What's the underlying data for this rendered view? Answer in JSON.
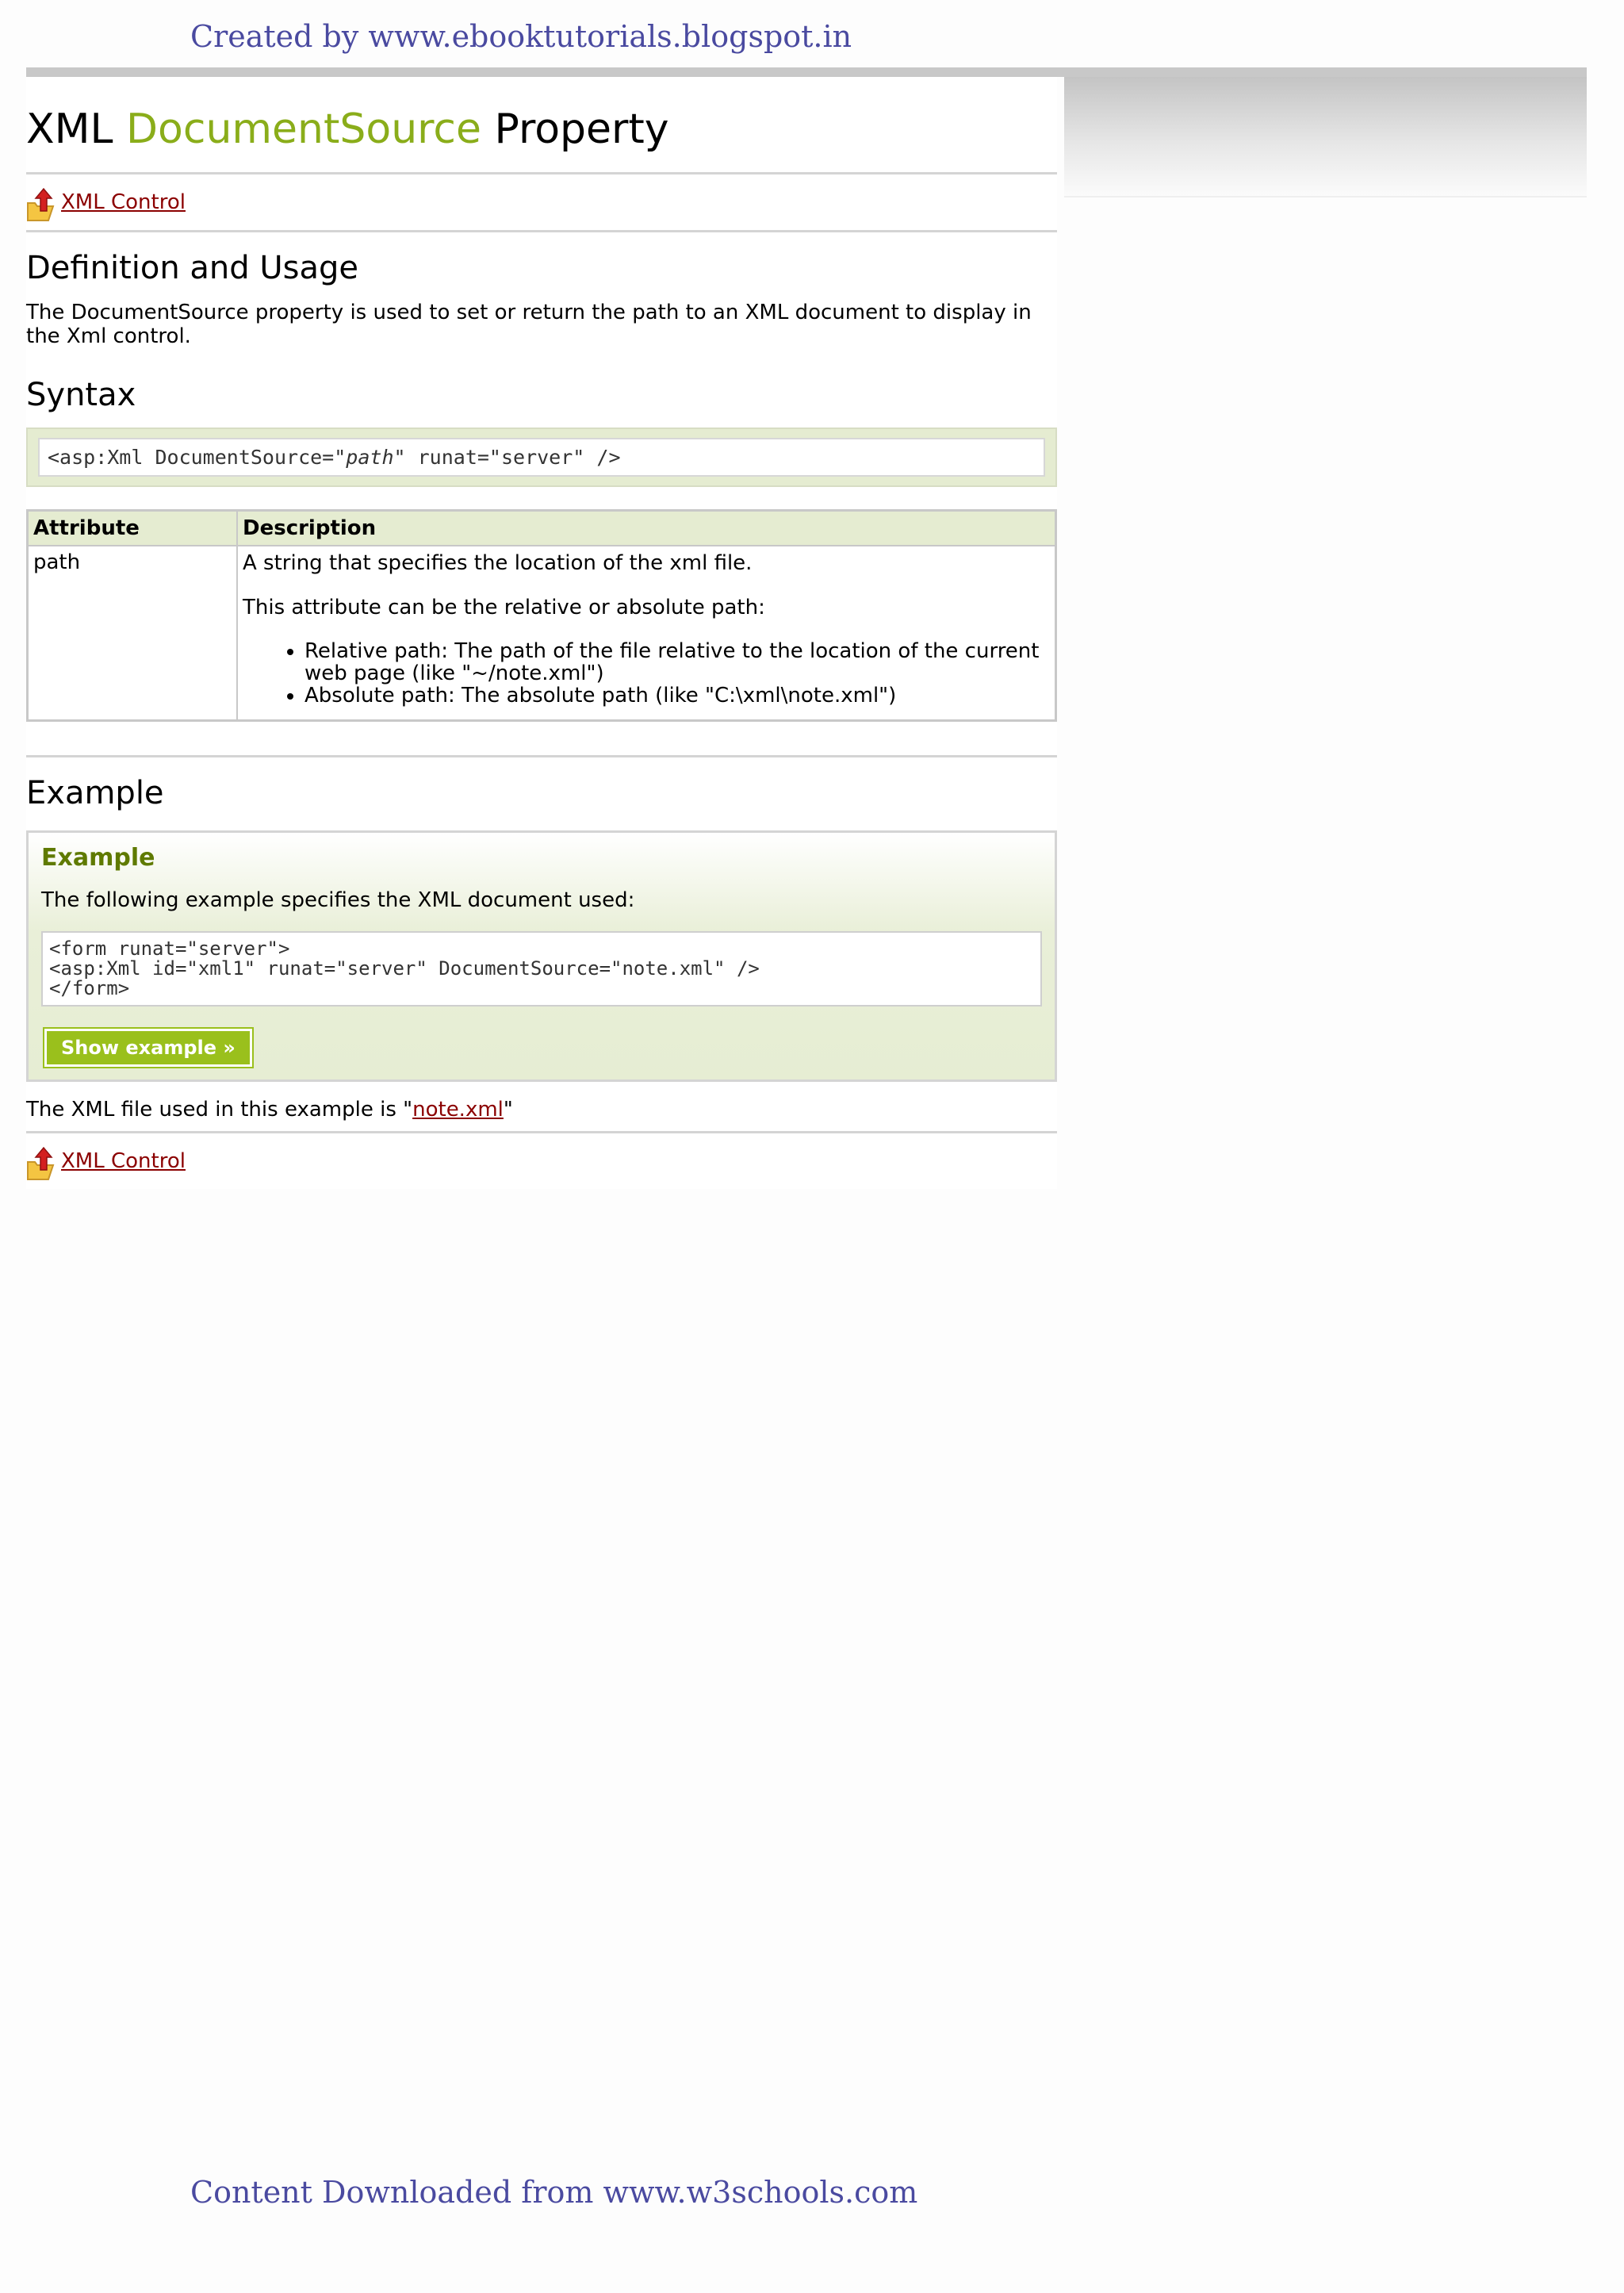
{
  "credits": {
    "top": "Created by www.ebooktutorials.blogspot.in",
    "bottom": "Content Downloaded from www.w3schools.com"
  },
  "title": {
    "part1": "XML ",
    "accent": "DocumentSource",
    "part2": " Property"
  },
  "nav": {
    "link_label": " XML Control"
  },
  "definition": {
    "heading": "Definition and Usage",
    "text": "The DocumentSource property is used to set or return the path to an XML document to display in the Xml control."
  },
  "syntax": {
    "heading": "Syntax",
    "code_before": "<asp:Xml DocumentSource=\"",
    "code_param": "path",
    "code_after": "\" runat=\"server\" />"
  },
  "attributes_table": {
    "headers": [
      "Attribute",
      "Description"
    ],
    "rows": [
      {
        "attribute": "path",
        "desc_line1": "A string that specifies the location of the xml file.",
        "desc_line2": "This attribute can be the relative or absolute path:",
        "bullets": [
          "Relative path: The path of the file relative to the location of the current web page (like \"~/note.xml\")",
          "Absolute path: The absolute path (like \"C:\\xml\\note.xml\")"
        ]
      }
    ]
  },
  "example": {
    "heading": "Example",
    "box_title": "Example",
    "description": "The following example specifies the XML document used:",
    "code": "<form runat=\"server\">\n<asp:Xml id=\"xml1\" runat=\"server\" DocumentSource=\"note.xml\" />\n</form>",
    "button_label": "Show example »",
    "after_prefix": "The XML file used in this example is \"",
    "after_link": "note.xml",
    "after_suffix": "\""
  },
  "colors": {
    "accent": "#8aad1a",
    "link": "#8b0000",
    "credit": "#4a4aa0",
    "button": "#9ac01c"
  },
  "icons": {
    "nav": "folder-up-arrow-icon"
  }
}
